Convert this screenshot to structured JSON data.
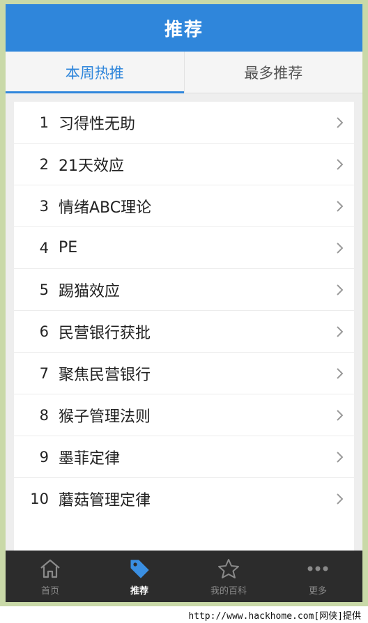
{
  "header": {
    "title": "推荐"
  },
  "tabs": [
    {
      "label": "本周热推",
      "active": true
    },
    {
      "label": "最多推荐",
      "active": false
    }
  ],
  "list": [
    {
      "num": "1",
      "label": "习得性无助"
    },
    {
      "num": "2",
      "label": "21天效应"
    },
    {
      "num": "3",
      "label": "情绪ABC理论"
    },
    {
      "num": "4",
      "label": "PE"
    },
    {
      "num": "5",
      "label": "踢猫效应"
    },
    {
      "num": "6",
      "label": "民营银行获批"
    },
    {
      "num": "7",
      "label": "聚焦民营银行"
    },
    {
      "num": "8",
      "label": "猴子管理法则"
    },
    {
      "num": "9",
      "label": "墨菲定律"
    },
    {
      "num": "10",
      "label": "蘑菇管理定律"
    }
  ],
  "bottom_nav": [
    {
      "label": "首页",
      "icon": "home-icon",
      "active": false
    },
    {
      "label": "推荐",
      "icon": "tag-icon",
      "active": true
    },
    {
      "label": "我的百科",
      "icon": "star-icon",
      "active": false
    },
    {
      "label": "更多",
      "icon": "more-icon",
      "active": false
    }
  ],
  "colors": {
    "accent": "#2f86db",
    "bottom_bar": "#2c2c2c",
    "frame": "#c9d9a8"
  },
  "watermark": "http://www.hackhome.com[网侠]提供"
}
